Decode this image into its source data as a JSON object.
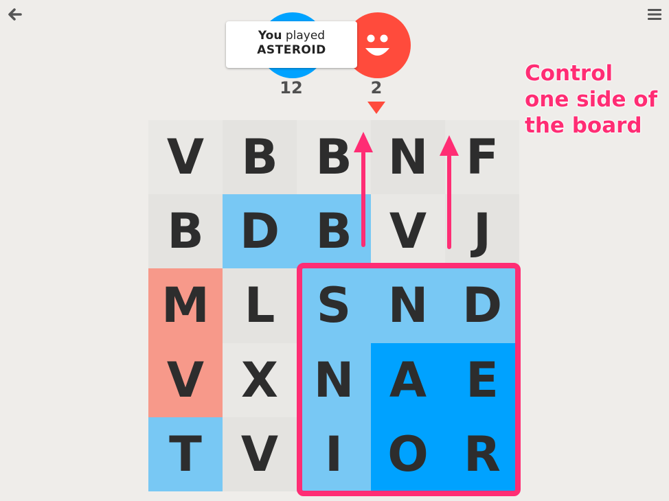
{
  "header": {
    "back_icon": "arrow-left-icon",
    "menu_icon": "hamburger-menu-icon"
  },
  "players": [
    {
      "side": "blue",
      "avatar": "avatar-hidden",
      "score": "12",
      "color": "#00a2ff"
    },
    {
      "side": "red",
      "avatar": "smiley-face",
      "score": "2",
      "color": "#ff4b3c"
    }
  ],
  "last_play": {
    "prefix": "You",
    "verb": "played",
    "word": "ASTEROID"
  },
  "turn_indicator": "red",
  "board": {
    "rows": [
      [
        {
          "letter": "V",
          "owner": "neutral"
        },
        {
          "letter": "B",
          "owner": "neutral"
        },
        {
          "letter": "B",
          "owner": "neutral"
        },
        {
          "letter": "N",
          "owner": "neutral"
        },
        {
          "letter": "F",
          "owner": "neutral"
        }
      ],
      [
        {
          "letter": "B",
          "owner": "neutral"
        },
        {
          "letter": "D",
          "owner": "blue"
        },
        {
          "letter": "B",
          "owner": "blue"
        },
        {
          "letter": "V",
          "owner": "neutral"
        },
        {
          "letter": "J",
          "owner": "neutral"
        }
      ],
      [
        {
          "letter": "M",
          "owner": "red"
        },
        {
          "letter": "L",
          "owner": "neutral"
        },
        {
          "letter": "S",
          "owner": "blue"
        },
        {
          "letter": "N",
          "owner": "blue"
        },
        {
          "letter": "D",
          "owner": "blue"
        }
      ],
      [
        {
          "letter": "V",
          "owner": "red"
        },
        {
          "letter": "X",
          "owner": "neutral"
        },
        {
          "letter": "N",
          "owner": "blue"
        },
        {
          "letter": "A",
          "owner": "blue-locked"
        },
        {
          "letter": "E",
          "owner": "blue-locked"
        }
      ],
      [
        {
          "letter": "T",
          "owner": "blue"
        },
        {
          "letter": "V",
          "owner": "neutral"
        },
        {
          "letter": "I",
          "owner": "blue"
        },
        {
          "letter": "O",
          "owner": "blue-locked"
        },
        {
          "letter": "R",
          "owner": "blue-locked"
        }
      ]
    ]
  },
  "annotation": {
    "text": "Control\none side of\nthe board",
    "color": "#ff2d74"
  }
}
